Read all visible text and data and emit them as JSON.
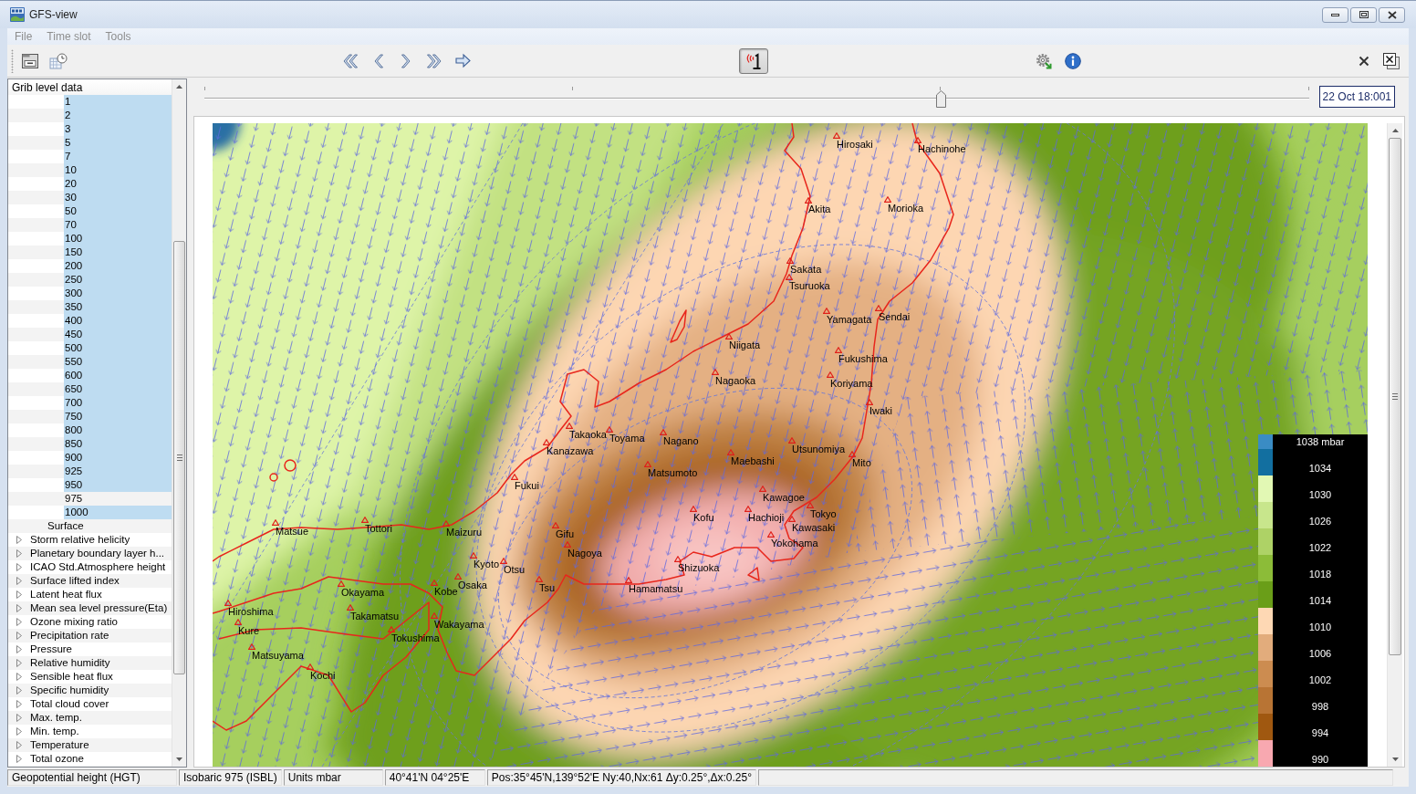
{
  "window": {
    "title": "GFS-view"
  },
  "menu": [
    "File",
    "Time slot",
    "Tools"
  ],
  "toolbar": {
    "display_toggle": {
      "on": true
    }
  },
  "time_slider": {
    "level": 0.667,
    "time": "22 Oct 18:001"
  },
  "tree": {
    "header": "Grib level data",
    "items": [
      {
        "children": [
          {
            "children": [
              {
                "label": "1",
                "selected": true
              },
              {
                "label": "2",
                "selected": true
              },
              {
                "label": "3",
                "selected": true
              },
              {
                "label": "5",
                "selected": true
              },
              {
                "label": "7",
                "selected": true
              },
              {
                "label": "10",
                "selected": true
              },
              {
                "label": "20",
                "selected": true
              },
              {
                "label": "30",
                "selected": true
              },
              {
                "label": "50",
                "selected": true
              },
              {
                "label": "70",
                "selected": true
              },
              {
                "label": "100",
                "selected": true
              },
              {
                "label": "150",
                "selected": true
              },
              {
                "label": "200",
                "selected": true
              },
              {
                "label": "250",
                "selected": true
              },
              {
                "label": "300",
                "selected": true
              },
              {
                "label": "350",
                "selected": true
              },
              {
                "label": "400",
                "selected": true
              },
              {
                "label": "450",
                "selected": true
              },
              {
                "label": "500",
                "selected": true
              },
              {
                "label": "550",
                "selected": true
              },
              {
                "label": "600",
                "selected": true
              },
              {
                "label": "650",
                "selected": true
              },
              {
                "label": "700",
                "selected": true
              },
              {
                "label": "750",
                "selected": true
              },
              {
                "label": "800",
                "selected": true
              },
              {
                "label": "850",
                "selected": true
              },
              {
                "label": "900",
                "selected": true
              },
              {
                "label": "925",
                "selected": true
              },
              {
                "label": "950",
                "selected": true
              },
              {
                "label": "975",
                "selected": false
              },
              {
                "label": "1000",
                "selected": true
              }
            ]
          },
          {
            "label": "Surface",
            "selected": false
          }
        ]
      },
      {
        "label": "Storm relative helicity",
        "expanded": false,
        "selected": false
      },
      {
        "label": "Planetary boundary layer h...",
        "expanded": false,
        "selected": false
      },
      {
        "label": "ICAO Std.Atmosphere height",
        "expanded": false,
        "selected": false
      },
      {
        "label": "Surface lifted index",
        "expanded": false,
        "selected": false
      },
      {
        "label": "Latent heat flux",
        "expanded": false,
        "selected": false
      },
      {
        "label": "Mean sea level pressure(Eta)",
        "expanded": false,
        "selected": false
      },
      {
        "label": "Ozone mixing ratio",
        "expanded": false,
        "selected": false
      },
      {
        "label": "Precipitation rate",
        "expanded": false,
        "selected": false
      },
      {
        "label": "Pressure",
        "expanded": false,
        "selected": false
      },
      {
        "label": "Relative humidity",
        "expanded": false,
        "selected": false
      },
      {
        "label": "Sensible heat flux",
        "expanded": false,
        "selected": false
      },
      {
        "label": "Specific humidity",
        "expanded": false,
        "selected": false
      },
      {
        "label": "Total cloud cover",
        "expanded": false,
        "selected": false
      },
      {
        "label": "Max. temp.",
        "expanded": false,
        "selected": false
      },
      {
        "label": "Min. temp.",
        "expanded": false,
        "selected": false
      },
      {
        "label": "Temperature",
        "expanded": false,
        "selected": false
      },
      {
        "label": "Total ozone",
        "expanded": false,
        "selected": false
      }
    ]
  },
  "map": {
    "cities": [
      "Hirosaki",
      "Hachinohe",
      "Akita",
      "Morioka",
      "Sakata",
      "Tsuruoka",
      "Yamagata",
      "Sendai",
      "Niigata",
      "Fukushima",
      "Nagaoka",
      "Koriyama",
      "Iwaki",
      "Takaoka",
      "Toyama",
      "Nagano",
      "Kanazawa",
      "Utsunomiya",
      "Maebashi",
      "Mito",
      "Matsumoto",
      "Fukui",
      "Kawagoe",
      "Kofu",
      "Hachioji",
      "Tokyo",
      "Matsue",
      "Tottori",
      "Maizuru",
      "Gifu",
      "Kawasaki",
      "Yokohama",
      "Nagoya",
      "Kyoto",
      "Otsu",
      "Shizuoka",
      "Okayama",
      "Kobe",
      "Osaka",
      "Tsu",
      "Hamamatsu",
      "Hiroshima",
      "Takamatsu",
      "Kure",
      "Wakayama",
      "Tokushima",
      "Matsuyama",
      "Kochi"
    ],
    "legend": [
      {
        "label": "1038 mbar",
        "color": "#3a8cc4"
      },
      {
        "label": "1034",
        "color": "#126fa0"
      },
      {
        "label": "1030",
        "color": "#e2f8b4"
      },
      {
        "label": "1026",
        "color": "#c8e68c"
      },
      {
        "label": "1022",
        "color": "#aed266"
      },
      {
        "label": "1018",
        "color": "#8cbc38"
      },
      {
        "label": "1014",
        "color": "#6a9e18"
      },
      {
        "label": "1010",
        "color": "#fed8b4"
      },
      {
        "label": "1006",
        "color": "#e2ac7c"
      },
      {
        "label": "1002",
        "color": "#cc8c50"
      },
      {
        "label": "998",
        "color": "#b87434"
      },
      {
        "label": "994",
        "color": "#a05810"
      },
      {
        "label": "990",
        "color": "#f8a8b0"
      }
    ]
  },
  "status_bar": [
    "Geopotential height (HGT)",
    "Isobaric 975 (ISBL)",
    "Units mbar",
    "40°41'N 04°25'E",
    "Pos:35°45'N,139°52'E Ny:40,Nx:61 Δy:0.25°,Δx:0.25°"
  ]
}
